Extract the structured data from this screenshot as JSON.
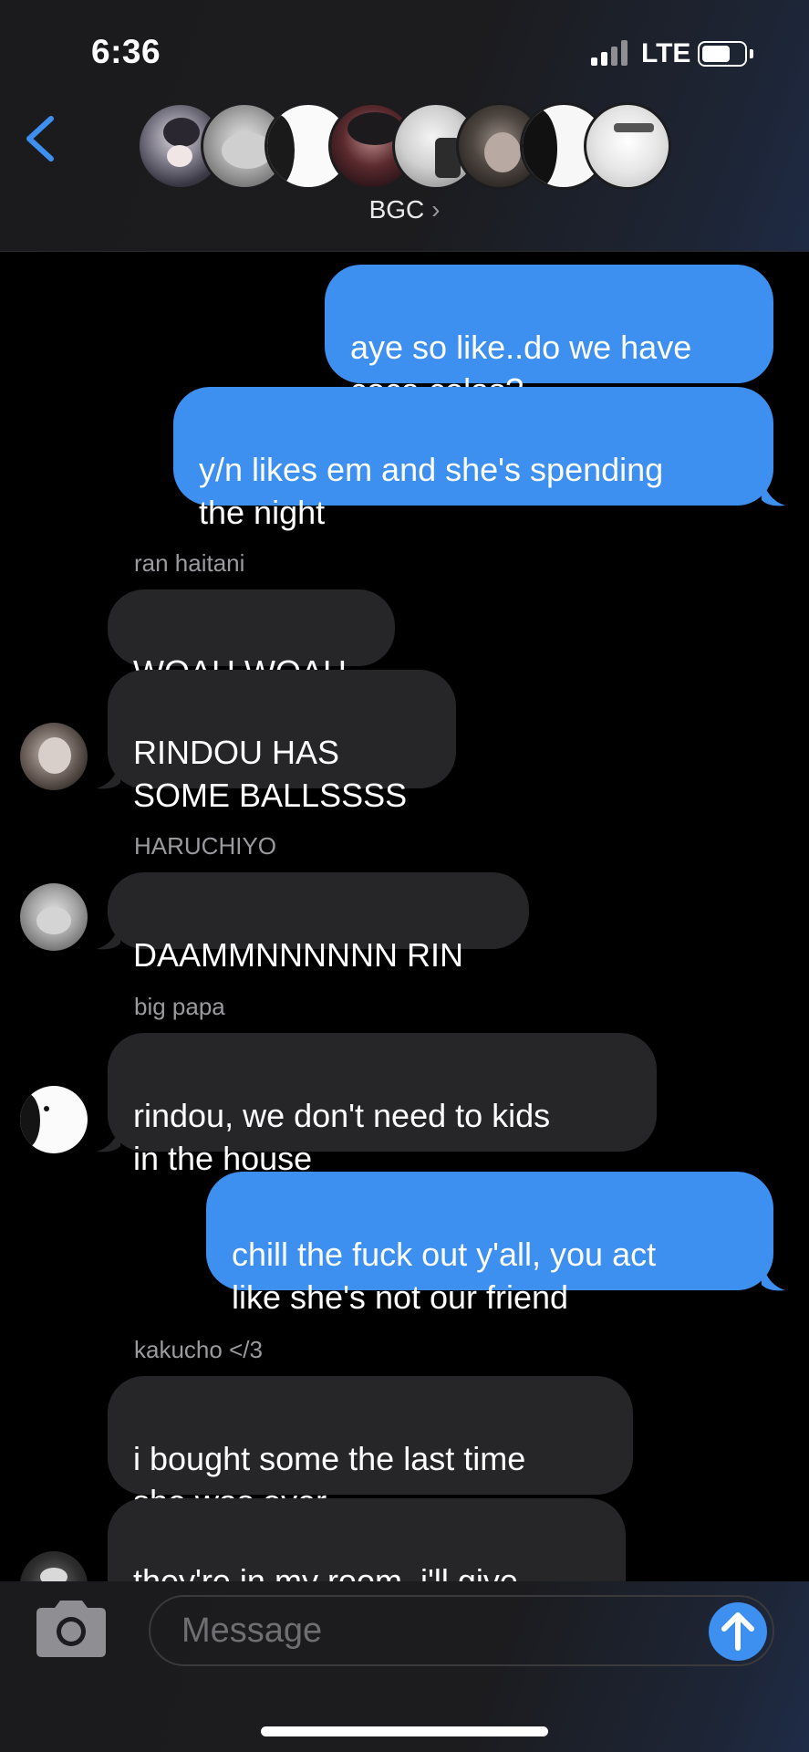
{
  "status_bar": {
    "time": "6:36",
    "network": "LTE"
  },
  "header": {
    "group_name": "BGC",
    "chevron": "›"
  },
  "messages": [
    {
      "sender_label": "",
      "text": "aye so like..do we have\ncoca colas?"
    },
    {
      "sender_label": "",
      "text": "y/n likes em and she's spending\nthe night"
    },
    {
      "sender_label": "ran haitani",
      "text": "WOAH WOAH"
    },
    {
      "sender_label": "",
      "text": "RINDOU HAS\nSOME BALLSSSS"
    },
    {
      "sender_label": "HARUCHIYO",
      "text": "DAAMMNNNNNN RIN"
    },
    {
      "sender_label": "big papa",
      "text": "rindou, we don't need to kids\nin the house"
    },
    {
      "sender_label": "",
      "text": "chill the fuck out y'all, you act\nlike she's not our friend"
    },
    {
      "sender_label": "kakucho </3",
      "text": "i bought some the last time\nshe was over"
    },
    {
      "sender_label": "",
      "text": "they're in my room, i'll give\nthem to you"
    }
  ],
  "input": {
    "placeholder": "Message"
  },
  "colors": {
    "sent_bubble": "#3d8ff0",
    "received_bubble": "#262629",
    "accent": "#3d8ff0",
    "background": "#000000"
  },
  "icons": [
    "back-chevron-icon",
    "camera-icon",
    "send-arrow-icon",
    "signal-icon",
    "battery-icon"
  ]
}
